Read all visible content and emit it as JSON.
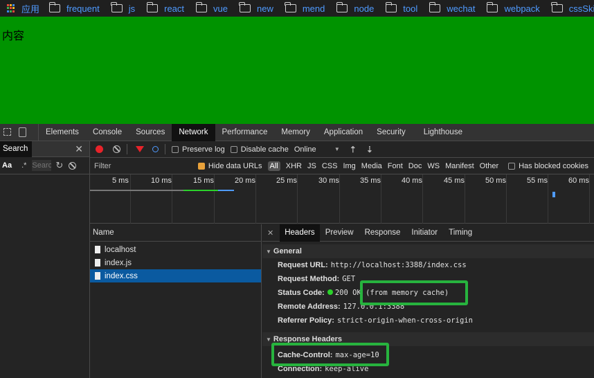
{
  "bookmarks": {
    "apps_label": "应用",
    "apps_icon": "apps-grid-icon",
    "folders": [
      "frequent",
      "js",
      "react",
      "vue",
      "new",
      "mend",
      "node",
      "tool",
      "wechat",
      "webpack",
      "cssSkill"
    ],
    "folder_icon": "folder-icon",
    "link_color": "#4f9bff"
  },
  "page": {
    "text": "内容",
    "background": "#009300"
  },
  "devtools": {
    "tabs": [
      "Elements",
      "Console",
      "Sources",
      "Network",
      "Performance",
      "Memory",
      "Application",
      "Security",
      "Lighthouse"
    ],
    "active_tab": "Network",
    "search_panel": {
      "title": "Search",
      "case_label": "Aa",
      "regex_label": ".*",
      "placeholder": "Search"
    },
    "toolbar": {
      "preserve_log": "Preserve log",
      "disable_cache": "Disable cache",
      "throttle": "Online"
    },
    "filter": {
      "placeholder": "Filter",
      "hide_data_urls": "Hide data URLs",
      "all": "All",
      "types": [
        "XHR",
        "JS",
        "CSS",
        "Img",
        "Media",
        "Font",
        "Doc",
        "WS",
        "Manifest",
        "Other"
      ],
      "blocked_cookies": "Has blocked cookies"
    },
    "timeline": {
      "ticks": [
        "5 ms",
        "10 ms",
        "15 ms",
        "20 ms",
        "25 ms",
        "30 ms",
        "35 ms",
        "40 ms",
        "45 ms",
        "50 ms",
        "55 ms",
        "60 ms"
      ]
    },
    "requests": {
      "column": "Name",
      "rows": [
        "localhost",
        "index.js",
        "index.css"
      ],
      "selected": "index.css"
    },
    "headers_panel": {
      "tabs": [
        "Headers",
        "Preview",
        "Response",
        "Initiator",
        "Timing"
      ],
      "active_tab": "Headers",
      "general_title": "General",
      "general": [
        {
          "k": "Request URL:",
          "v": "http://localhost:3388/index.css"
        },
        {
          "k": "Request Method:",
          "v": "GET"
        },
        {
          "k": "Status Code:",
          "v": "200 OK (from memory cache)"
        },
        {
          "k": "Remote Address:",
          "v": "127.0.0.1:3388"
        },
        {
          "k": "Referrer Policy:",
          "v": "strict-origin-when-cross-origin"
        }
      ],
      "response_title": "Response Headers",
      "response": [
        {
          "k": "Cache-Control:",
          "v": "max-age=10"
        },
        {
          "k": "Connection:",
          "v": "keep-alive"
        }
      ]
    },
    "highlight_color": "#27b33e"
  }
}
